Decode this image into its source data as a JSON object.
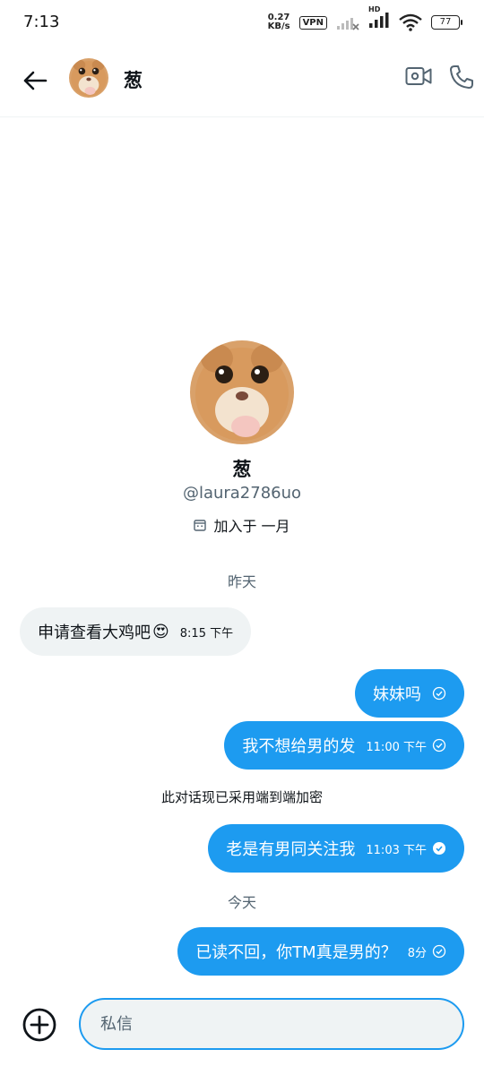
{
  "status_bar": {
    "time": "7:13",
    "speed_value": "0.27",
    "speed_unit": "KB/s",
    "vpn": "VPN",
    "hd": "HD",
    "battery": "77"
  },
  "header": {
    "contact_name": "葱",
    "icons": {
      "back": "arrow-left-icon",
      "video": "video-camera-icon",
      "call": "phone-icon"
    }
  },
  "profile": {
    "name": "葱",
    "handle": "@laura2786uo",
    "joined": "加入于 一月"
  },
  "conversation": {
    "day_yesterday": "昨天",
    "msg1": {
      "text": "申请查看大鸡吧",
      "emoji": "😍",
      "time": "8:15 下午"
    },
    "msg2": {
      "text": "妹妹吗"
    },
    "msg3": {
      "text": "我不想给男的发",
      "time": "11:00 下午"
    },
    "system_notice": "此对话现已采用端到端加密",
    "msg4": {
      "text": "老是有男同关注我",
      "time": "11:03 下午"
    },
    "day_today": "今天",
    "msg5": {
      "text": "已读不回，你TM真是男的？",
      "time": "8分"
    }
  },
  "composer": {
    "placeholder": "私信"
  },
  "colors": {
    "accent": "#1d9bf0",
    "incoming_bubble": "#eff3f4",
    "secondary_text": "#536471"
  }
}
